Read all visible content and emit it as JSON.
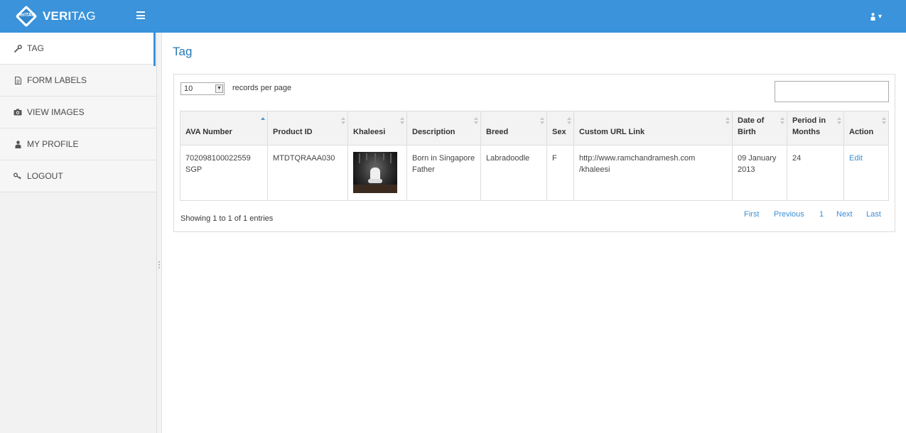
{
  "app": {
    "logo_text": "veriTAG",
    "brand_bold": "VERI",
    "brand_regular": "TAG"
  },
  "user_menu": {
    "caret": "▾"
  },
  "sidebar": {
    "items": [
      {
        "label": "TAG",
        "icon": "wrench-icon"
      },
      {
        "label": "FORM LABELS",
        "icon": "document-icon"
      },
      {
        "label": "VIEW IMAGES",
        "icon": "camera-icon"
      },
      {
        "label": "MY PROFILE",
        "icon": "user-icon"
      },
      {
        "label": "LOGOUT",
        "icon": "key-icon"
      }
    ]
  },
  "page": {
    "title": "Tag"
  },
  "table_controls": {
    "page_length": "10",
    "length_label": "records per page",
    "search_value": ""
  },
  "table": {
    "columns": [
      "AVA Number",
      "Product ID",
      "Khaleesi",
      "Description",
      "Breed",
      "Sex",
      "Custom URL Link",
      "Date of Birth",
      "Period in Months",
      "Action"
    ],
    "rows": [
      {
        "ava_number": "702098100022559 SGP",
        "product_id": "MTDTQRAAA030",
        "image": "dog on throne",
        "description": "Born in Singapore Father",
        "breed": "Labradoodle",
        "sex": "F",
        "url": "http://www.ramchandramesh.com /khaleesi",
        "dob": "09 January 2013",
        "period": "24",
        "action": "Edit"
      }
    ]
  },
  "footer": {
    "info": "Showing 1 to 1 of 1 entries",
    "pager": {
      "first": "First",
      "previous": "Previous",
      "page": "1",
      "next": "Next",
      "last": "Last"
    }
  },
  "colors": {
    "accent": "#3a93db",
    "link": "#3a8ed5",
    "title": "#2679b5"
  }
}
